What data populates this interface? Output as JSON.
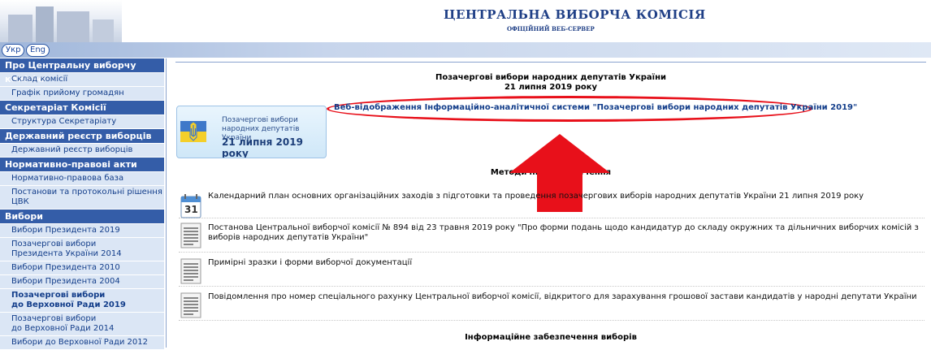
{
  "header": {
    "title": "ЦЕНТРАЛЬНА ВИБОРЧА КОМІСІЯ",
    "subtitle": "ОФІЦІЙНИЙ ВЕБ-СЕРВЕР",
    "lang_ukr": "Укр",
    "lang_eng": "Eng"
  },
  "sidebar": {
    "sections": [
      {
        "title": "Про Центральну виборчу комісію",
        "items": [
          "Склад комісії",
          "Графік прийому громадян"
        ]
      },
      {
        "title": "Секретаріат Комісії",
        "items": [
          "Структура Секретаріату"
        ]
      },
      {
        "title": "Державний реєстр виборців",
        "items": [
          "Державний реєстр виборців"
        ]
      },
      {
        "title": "Нормативно-правові акти",
        "items": [
          "Нормативно-правова база",
          "Постанови та протокольні рішення ЦВК"
        ]
      },
      {
        "title": "Вибори",
        "items": [
          "Вибори Президента 2019",
          "Позачергові вибори\nПрезидента України 2014",
          "Вибори Президента 2010",
          "Вибори Президента 2004",
          "Позачергові вибори\nдо Верховної Ради 2019",
          "Позачергові вибори\nдо Верховної Ради 2014",
          "Вибори до Верховної Ради 2012"
        ]
      }
    ]
  },
  "main": {
    "title_line1": "Позачергові вибори народних депутатів України",
    "title_line2": "21 липня 2019 року",
    "banner_text1": "Позачергові вибори",
    "banner_text2": "народних депутатів України",
    "banner_date": "21 липня 2019 року",
    "veb_link": "Веб-відображення Інформаційно-аналітичної системи \"Позачергові вибори народних депутатів України 2019\"",
    "method_heading": "Методичне забезпечення",
    "calendar_day": "31",
    "docs": [
      "Календарний план основних організаційних заходів з підготовки та проведення позачергових виборів народних депутатів України 21 липня 2019 року",
      "Постанова Центральної виборчої комісії № 894 від 23 травня 2019 року \"Про форми подань щодо кандидатур до складу окружних та дільничних виборчих комісій з виборів народних депутатів України\"",
      "Примірні зразки і форми виборчої документації",
      "Повідомлення про номер спеціального рахунку Центральної виборчої комісії, відкритого для зарахування грошової застави кандидатів у народні депутати України"
    ],
    "info_heading": "Інформаційне забезпечення виборів"
  },
  "colors": {
    "accent": "#345da8",
    "highlight": "#e8101a"
  }
}
